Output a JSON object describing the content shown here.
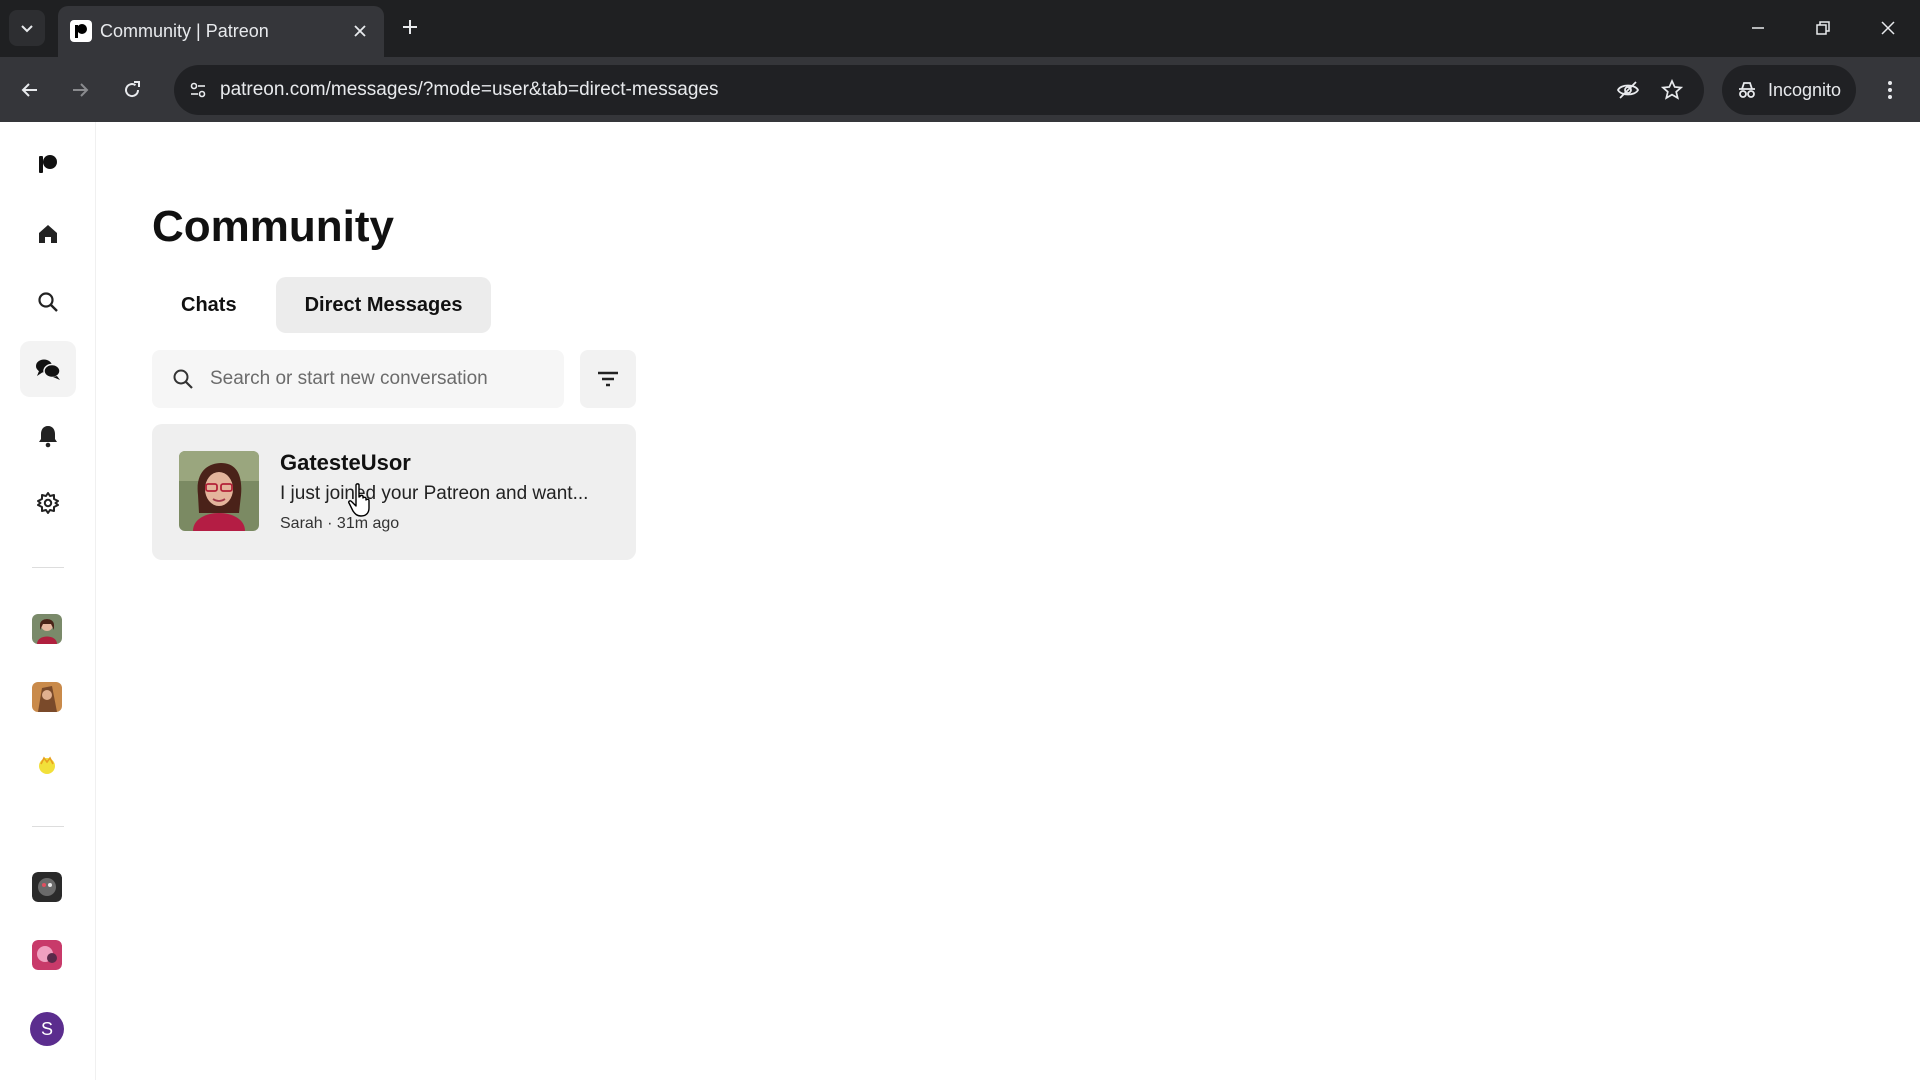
{
  "browser": {
    "tab_title": "Community | Patreon",
    "url": "patreon.com/messages/?mode=user&tab=direct-messages",
    "incognito_label": "Incognito"
  },
  "sidebar": {
    "items": [
      {
        "name": "patreon-logo-icon"
      },
      {
        "name": "home-icon"
      },
      {
        "name": "search-icon"
      },
      {
        "name": "chat-icon",
        "active": true
      },
      {
        "name": "bell-icon"
      },
      {
        "name": "gear-icon"
      }
    ],
    "user_initial": "S"
  },
  "page": {
    "title": "Community",
    "tabs": [
      {
        "label": "Chats",
        "active": false
      },
      {
        "label": "Direct Messages",
        "active": true
      }
    ],
    "search_placeholder": "Search or start new conversation"
  },
  "conversations": [
    {
      "name": "GatesteUsor",
      "preview": "I just joined your Patreon and want...",
      "meta": "Sarah · 31m ago"
    }
  ],
  "colors": {
    "chrome_dark": "#1f2022",
    "chrome_toolbar": "#35363a",
    "user_avatar": "#5b2d8e"
  }
}
